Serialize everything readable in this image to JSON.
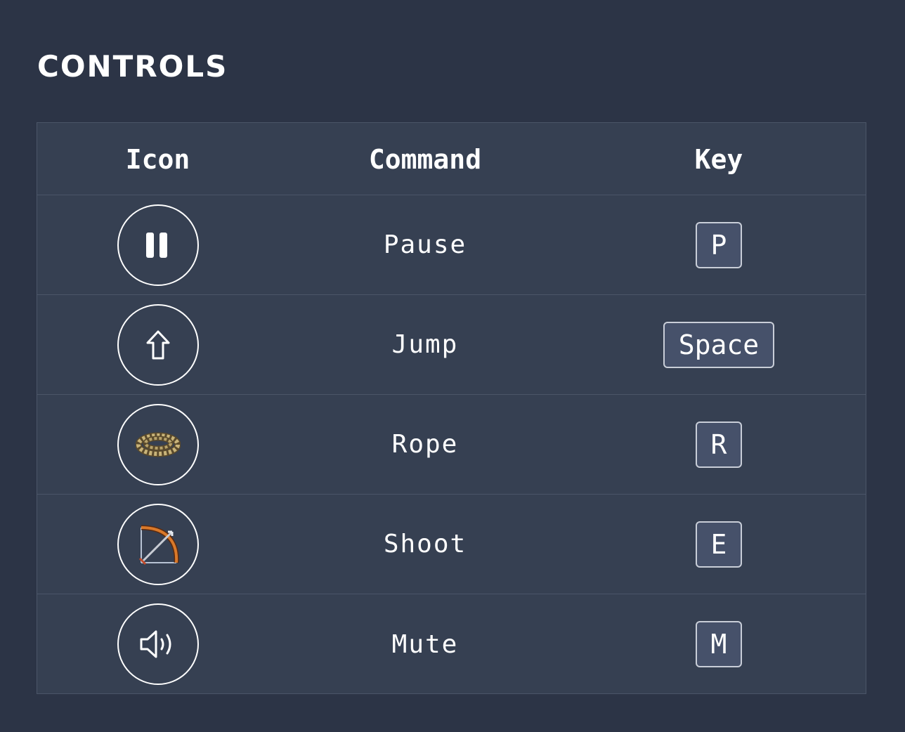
{
  "title": "CONTROLS",
  "columns": {
    "icon": "Icon",
    "command": "Command",
    "key": "Key"
  },
  "rows": [
    {
      "icon": "pause-icon",
      "command": "Pause",
      "key": "P"
    },
    {
      "icon": "up-arrow-icon",
      "command": "Jump",
      "key": "Space"
    },
    {
      "icon": "rope-icon",
      "command": "Rope",
      "key": "R"
    },
    {
      "icon": "bow-and-arrow-icon",
      "command": "Shoot",
      "key": "E"
    },
    {
      "icon": "speaker-icon",
      "command": "Mute",
      "key": "M"
    }
  ],
  "colors": {
    "background": "#2c3446",
    "table": "#364052",
    "border": "#4b5568",
    "keycap": "#46516a",
    "text": "#ffffff"
  }
}
